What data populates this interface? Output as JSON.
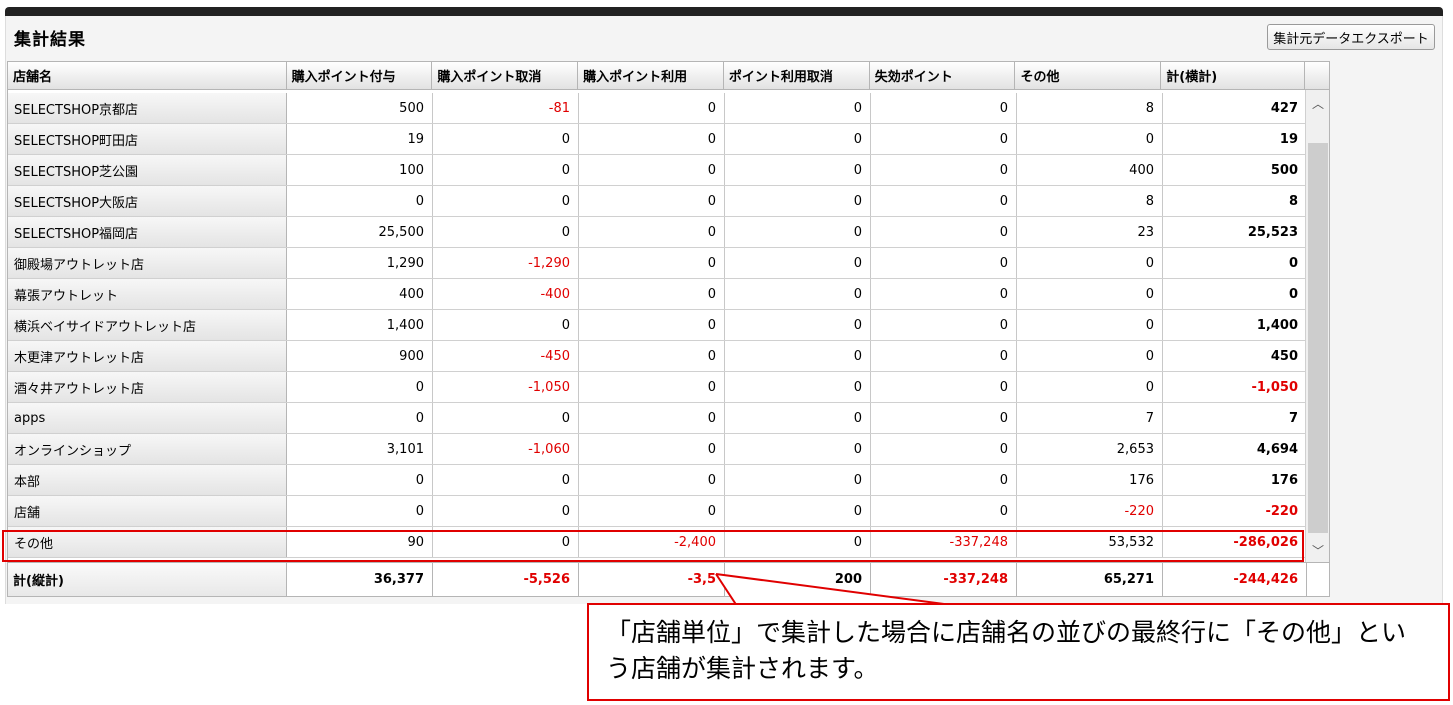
{
  "panel": {
    "title": "集計結果",
    "export_label": "集計元データエクスポート"
  },
  "columns": [
    "店舗名",
    "購入ポイント付与",
    "購入ポイント取消",
    "購入ポイント利用",
    "ポイント利用取消",
    "失効ポイント",
    "その他",
    "計(横計)"
  ],
  "rows": [
    {
      "name": "SELECTSHOP京都店",
      "values": [
        "500",
        "-81",
        "0",
        "0",
        "0",
        "8",
        "427"
      ]
    },
    {
      "name": "SELECTSHOP町田店",
      "values": [
        "19",
        "0",
        "0",
        "0",
        "0",
        "0",
        "19"
      ]
    },
    {
      "name": "SELECTSHOP芝公園",
      "values": [
        "100",
        "0",
        "0",
        "0",
        "0",
        "400",
        "500"
      ]
    },
    {
      "name": "SELECTSHOP大阪店",
      "values": [
        "0",
        "0",
        "0",
        "0",
        "0",
        "8",
        "8"
      ]
    },
    {
      "name": "SELECTSHOP福岡店",
      "values": [
        "25,500",
        "0",
        "0",
        "0",
        "0",
        "23",
        "25,523"
      ]
    },
    {
      "name": "御殿場アウトレット店",
      "values": [
        "1,290",
        "-1,290",
        "0",
        "0",
        "0",
        "0",
        "0"
      ]
    },
    {
      "name": "幕張アウトレット",
      "values": [
        "400",
        "-400",
        "0",
        "0",
        "0",
        "0",
        "0"
      ]
    },
    {
      "name": "横浜ベイサイドアウトレット店",
      "values": [
        "1,400",
        "0",
        "0",
        "0",
        "0",
        "0",
        "1,400"
      ]
    },
    {
      "name": "木更津アウトレット店",
      "values": [
        "900",
        "-450",
        "0",
        "0",
        "0",
        "0",
        "450"
      ]
    },
    {
      "name": "酒々井アウトレット店",
      "values": [
        "0",
        "-1,050",
        "0",
        "0",
        "0",
        "0",
        "-1,050"
      ]
    },
    {
      "name": "apps",
      "values": [
        "0",
        "0",
        "0",
        "0",
        "0",
        "7",
        "7"
      ]
    },
    {
      "name": "オンラインショップ",
      "values": [
        "3,101",
        "-1,060",
        "0",
        "0",
        "0",
        "2,653",
        "4,694"
      ]
    },
    {
      "name": "本部",
      "values": [
        "0",
        "0",
        "0",
        "0",
        "0",
        "176",
        "176"
      ]
    },
    {
      "name": "店舗",
      "values": [
        "0",
        "0",
        "0",
        "0",
        "0",
        "-220",
        "-220"
      ]
    },
    {
      "name": "その他",
      "values": [
        "90",
        "0",
        "-2,400",
        "0",
        "-337,248",
        "53,532",
        "-286,026"
      ]
    }
  ],
  "total": {
    "label": "計(縦計)",
    "values": [
      "36,377",
      "-5,526",
      "-3,5",
      "200",
      "-337,248",
      "65,271",
      "-244,426"
    ]
  },
  "scrollbar": {
    "up_icon": "︿",
    "down_icon": "﹀"
  },
  "callout": {
    "text": "「店舗単位」で集計した場合に店舗名の並びの最終行に「その他」という店舗が集計されます。"
  },
  "colors": {
    "negative": "#e00000",
    "highlight": "#e00000"
  }
}
